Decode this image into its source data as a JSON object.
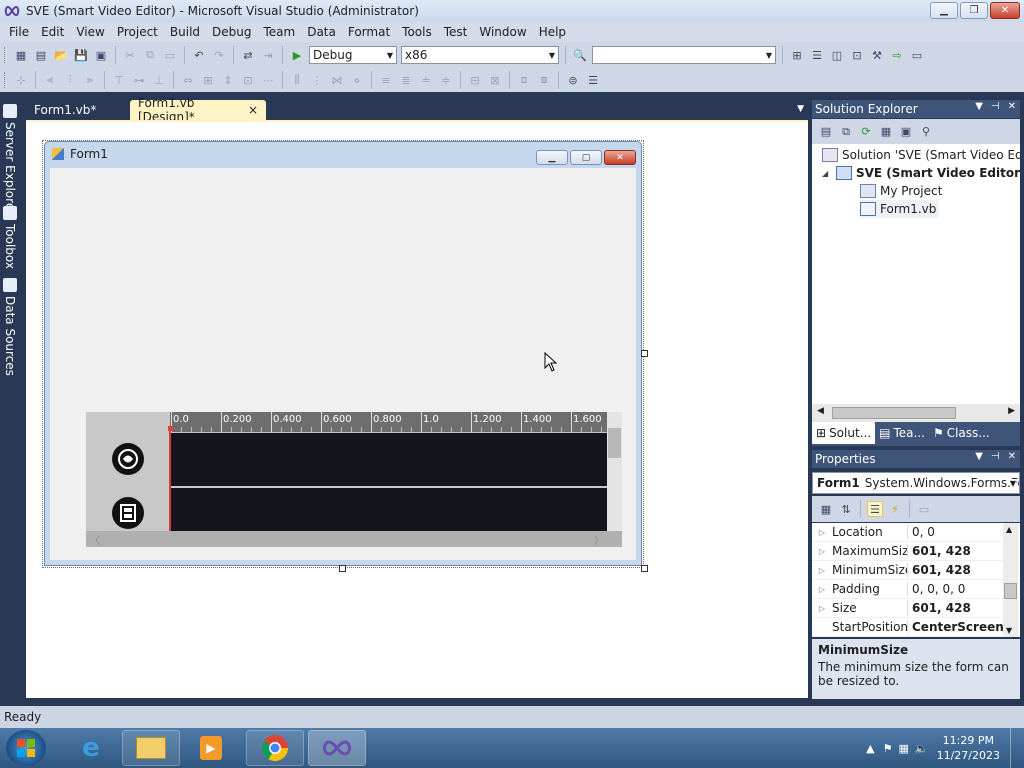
{
  "window": {
    "title": "SVE (Smart Video Editor) - Microsoft Visual Studio (Administrator)",
    "icons": {
      "app": "vs-infinity-icon",
      "minimize": "minimize-icon",
      "maximize": "restore-icon",
      "close": "close-icon"
    }
  },
  "menu": [
    "File",
    "Edit",
    "View",
    "Project",
    "Build",
    "Debug",
    "Team",
    "Data",
    "Format",
    "Tools",
    "Test",
    "Window",
    "Help"
  ],
  "toolbar": {
    "configuration": "Debug",
    "platform": "x86",
    "find_value": ""
  },
  "left_strip": [
    "Server Explorer",
    "Toolbox",
    "Data Sources"
  ],
  "doc_tabs": [
    {
      "label": "Form1.vb*",
      "active": false
    },
    {
      "label": "Form1.vb [Design]*",
      "active": true,
      "close": "×"
    }
  ],
  "designer": {
    "form_title": "Form1",
    "timeline": {
      "ruler_labels": [
        "0.0",
        "0.200",
        "0.400",
        "0.600",
        "0.800",
        "1.0",
        "1.200",
        "1.400",
        "1.600"
      ],
      "tracks": [
        {
          "name": "audio-track",
          "icon": "audio-track-icon"
        },
        {
          "name": "video-track",
          "icon": "film-track-icon"
        }
      ]
    }
  },
  "solution_explorer": {
    "title": "Solution Explorer",
    "tree": [
      {
        "label": "Solution 'SVE (Smart Video Editor)",
        "level": 0,
        "bold": false
      },
      {
        "label": "SVE (Smart Video Editor)",
        "level": 1,
        "bold": true,
        "expander": "◢"
      },
      {
        "label": "My Project",
        "level": 2,
        "bold": false
      },
      {
        "label": "Form1.vb",
        "level": 2,
        "bold": false
      }
    ],
    "tabs": [
      "Solut...",
      "Tea...",
      "Class..."
    ]
  },
  "properties": {
    "title": "Properties",
    "object_name": "Form1",
    "object_type": "System.Windows.Forms.Fo",
    "rows": [
      {
        "name": "Location",
        "value": "0, 0",
        "bold": false
      },
      {
        "name": "MaximumSize",
        "value": "601, 428",
        "bold": true
      },
      {
        "name": "MinimumSize",
        "value": "601, 428",
        "bold": true
      },
      {
        "name": "Padding",
        "value": "0, 0, 0, 0",
        "bold": false
      },
      {
        "name": "Size",
        "value": "601, 428",
        "bold": true
      },
      {
        "name": "StartPosition",
        "value": "CenterScreen",
        "bold": true
      }
    ],
    "description_title": "MinimumSize",
    "description_text": "The minimum size the form can be resized to."
  },
  "status": {
    "text": "Ready"
  },
  "taskbar": {
    "apps": [
      "internet-explorer",
      "file-explorer",
      "media-player",
      "chrome",
      "visual-studio"
    ],
    "time": "11:29 PM",
    "date": "11/27/2023"
  },
  "colors": {
    "accent": "#293955",
    "active_tab": "#fdf3c4",
    "track_bg": "#15161d",
    "playhead": "#d63a3a"
  }
}
